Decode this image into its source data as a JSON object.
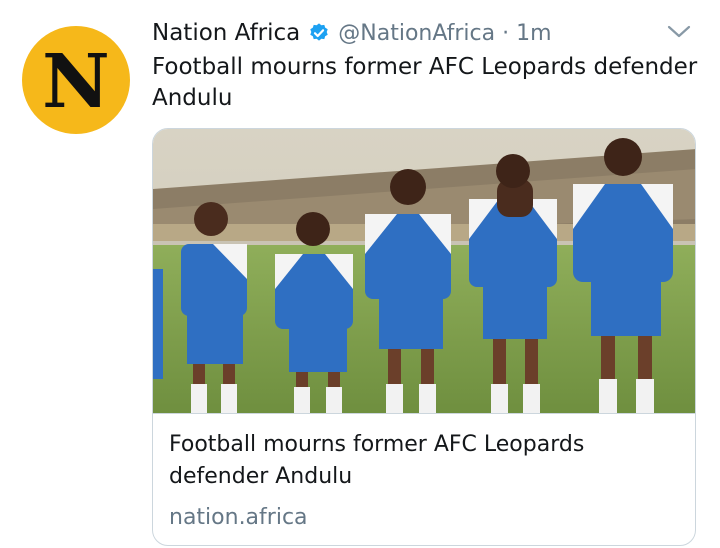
{
  "tweet": {
    "avatar_letter": "N",
    "display_name": "Nation Africa",
    "verified_icon": "verified-badge-icon",
    "handle": "@NationAfrica",
    "separator": "·",
    "time": "1m",
    "menu_icon": "chevron-down-icon",
    "text": "Football mourns former AFC Leopards defender Andulu"
  },
  "card": {
    "image_icon": "team-photo-image",
    "title": "Football mourns former AFC Leopards defender Andulu",
    "domain": "nation.africa"
  },
  "colors": {
    "avatar_bg": "#f6b81a",
    "verified_blue": "#1da1f2",
    "secondary_text": "#657786",
    "border": "#ccd6dd"
  }
}
